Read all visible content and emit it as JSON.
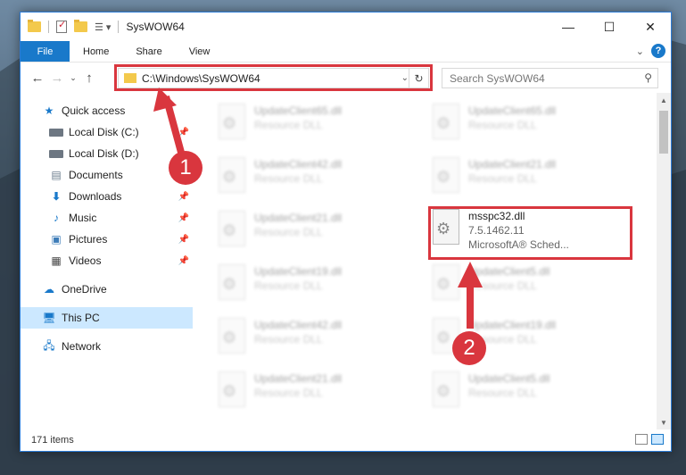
{
  "window": {
    "title": "SysWOW64"
  },
  "controls": {
    "minimize": "—",
    "maximize": "☐",
    "close": "✕"
  },
  "ribbon": {
    "file": "File",
    "tabs": [
      "Home",
      "Share",
      "View"
    ],
    "help": "?"
  },
  "address": {
    "path": "C:\\Windows\\SysWOW64",
    "refresh": "↻"
  },
  "search": {
    "placeholder": "Search SysWOW64"
  },
  "sidebar": {
    "quick_access": "Quick access",
    "items": [
      {
        "label": "Local Disk (C:)",
        "icon": "disk-icon",
        "pinned": true
      },
      {
        "label": "Local Disk (D:)",
        "icon": "disk-icon",
        "pinned": false
      },
      {
        "label": "Documents",
        "icon": "documents-icon",
        "pinned": true
      },
      {
        "label": "Downloads",
        "icon": "downloads-icon",
        "pinned": true
      },
      {
        "label": "Music",
        "icon": "music-icon",
        "pinned": true
      },
      {
        "label": "Pictures",
        "icon": "pictures-icon",
        "pinned": true
      },
      {
        "label": "Videos",
        "icon": "videos-icon",
        "pinned": true
      }
    ],
    "onedrive": "OneDrive",
    "this_pc": "This PC",
    "network": "Network"
  },
  "files": {
    "left": [
      {
        "name": "UpdateClient65.dll",
        "type": "Resource DLL"
      },
      {
        "name": "UpdateClient42.dll",
        "type": "Resource DLL"
      },
      {
        "name": "UpdateClient21.dll",
        "type": "Resource DLL"
      },
      {
        "name": "UpdateClient19.dll",
        "type": "Resource DLL"
      },
      {
        "name": "UpdateClient42.dll",
        "type": "Resource DLL"
      },
      {
        "name": "UpdateClient21.dll",
        "type": "Resource DLL"
      }
    ],
    "right": [
      {
        "name": "UpdateClient65.dll",
        "type": "Resource DLL"
      },
      {
        "name": "UpdateClient21.dll",
        "type": "Resource DLL"
      },
      {
        "name": "msspc32.dll",
        "version": "7.5.1462.11",
        "type": "MicrosoftA® Sched..."
      },
      {
        "name": "UpdateClient5.dll",
        "type": "Resource DLL"
      },
      {
        "name": "UpdateClient19.dll",
        "type": "Resource DLL"
      },
      {
        "name": "UpdateClient5.dll",
        "type": "Resource DLL"
      }
    ]
  },
  "status": {
    "count": "171 items"
  },
  "annotations": {
    "step1": "1",
    "step2": "2",
    "color": "#d9363e"
  }
}
